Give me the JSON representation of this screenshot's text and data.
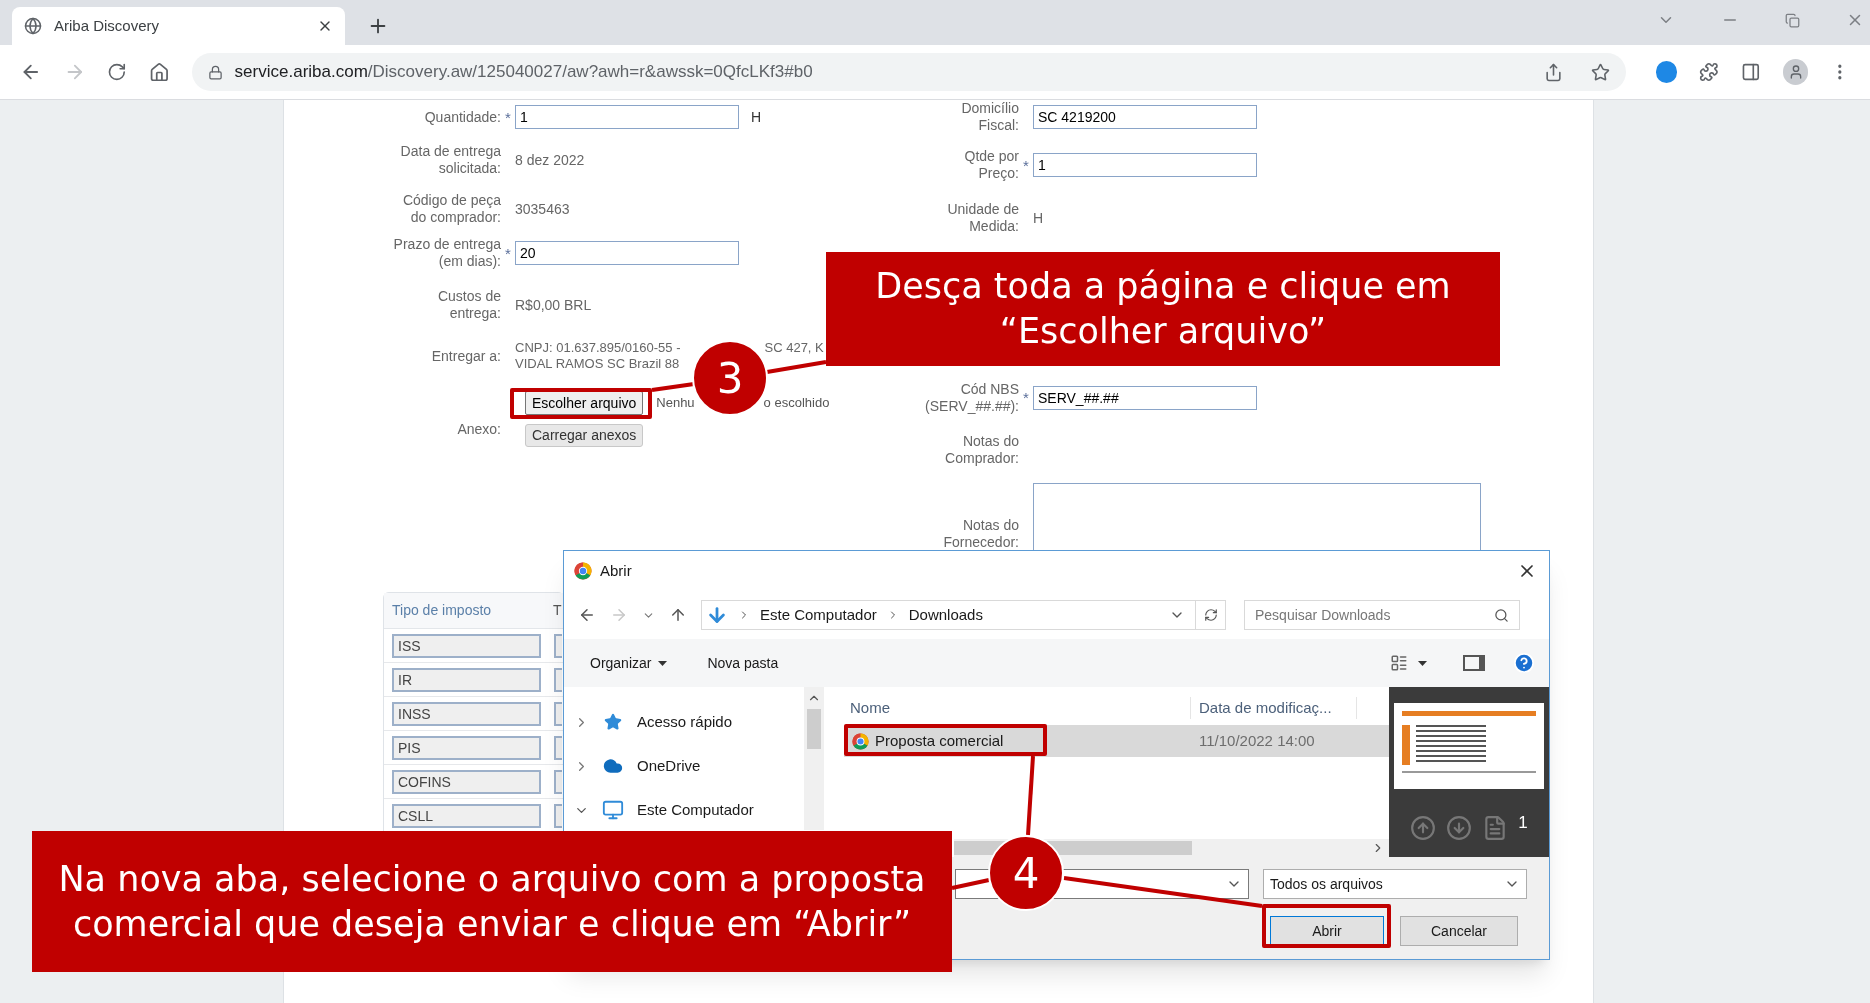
{
  "required_mark": "*",
  "browser": {
    "tab": {
      "title": "Ariba Discovery",
      "selected": true
    },
    "url_host": "service.ariba.com",
    "url_path": "/Discovery.aw/125040027/aw?awh=r&awssk=0QfcLKf3#b0",
    "forward_disabled": true
  },
  "form_left": [
    {
      "kind": "input",
      "label": [
        "Quantidade:"
      ],
      "required": true,
      "value": "1",
      "unit": "H"
    },
    {
      "kind": "text",
      "label": [
        "Data de entrega",
        "solicitada:"
      ],
      "required": false,
      "value": "8 dez 2022"
    },
    {
      "kind": "text",
      "label": [
        "Código de peça",
        "do comprador:"
      ],
      "required": false,
      "value": "3035463"
    },
    {
      "kind": "input",
      "label": [
        "Prazo de entrega",
        "(em dias):"
      ],
      "required": true,
      "value": "20"
    },
    {
      "kind": "text",
      "label": [
        "Custos de",
        "entrega:"
      ],
      "required": false,
      "value": "R$0,00 BRL"
    },
    {
      "kind": "address",
      "label": [
        "Entregar a:"
      ],
      "required": false,
      "lines": [
        [
          "CNPJ: 01.637.895/0160-55 -",
          "SC 427, K"
        ],
        [
          "VIDAL RAMOS SC Brazil 88"
        ]
      ]
    }
  ],
  "attachment": {
    "label": "Anexo:",
    "choose_button": "Escolher arquivo",
    "status": [
      "Nenhu",
      "o escolhido"
    ],
    "upload_button": "Carregar anexos"
  },
  "form_right": [
    {
      "kind": "input",
      "label": [
        "Domicílio",
        "Fiscal:"
      ],
      "required": false,
      "value": "SC 4219200"
    },
    {
      "kind": "input",
      "label": [
        "Qtde por",
        "Preço:"
      ],
      "required": true,
      "value": "1"
    },
    {
      "kind": "text",
      "label": [
        "Unidade de",
        "Medida:"
      ],
      "required": false,
      "value": "H"
    },
    {
      "kind": "input",
      "label": [
        "Cód NBS",
        "(SERV_##.##):"
      ],
      "required": true,
      "value": "SERV_##.##"
    },
    {
      "kind": "text",
      "label": [
        "Notas do",
        "Comprador:"
      ],
      "required": false
    },
    {
      "kind": "textarea",
      "label": [
        "Notas do",
        "Fornecedor:"
      ],
      "required": false
    }
  ],
  "tax_table": {
    "columns": [
      "Tipo de imposto",
      "T"
    ],
    "rows": [
      "ISS",
      "IR",
      "INSS",
      "PIS",
      "COFINS",
      "CSLL"
    ]
  },
  "dialog": {
    "title": "Abrir",
    "path": [
      "Este Computador",
      "Downloads"
    ],
    "search_placeholder": "Pesquisar Downloads",
    "toolbar": [
      "Organizar",
      "Nova pasta"
    ],
    "forward_disabled": true,
    "nav": [
      {
        "label": "Acesso rápido",
        "expanded": false
      },
      {
        "label": "OneDrive",
        "expanded": false
      },
      {
        "label": "Este Computador",
        "expanded": true
      }
    ],
    "columns": [
      "Nome",
      "Data de modificaç..."
    ],
    "files": [
      {
        "name": "Proposta comercial",
        "date": "11/10/2022 14:00",
        "selected": true
      }
    ],
    "preview_page": "1",
    "filetype": "Todos os arquivos",
    "open_button": "Abrir",
    "cancel_button": "Cancelar"
  },
  "callouts": [
    {
      "number": "3",
      "text": "Desça toda a página e clique em “Escolher arquivo”"
    },
    {
      "number": "4",
      "text": "Na nova aba, selecione o arquivo com a proposta comercial que deseja enviar e clique em “Abrir”"
    }
  ]
}
